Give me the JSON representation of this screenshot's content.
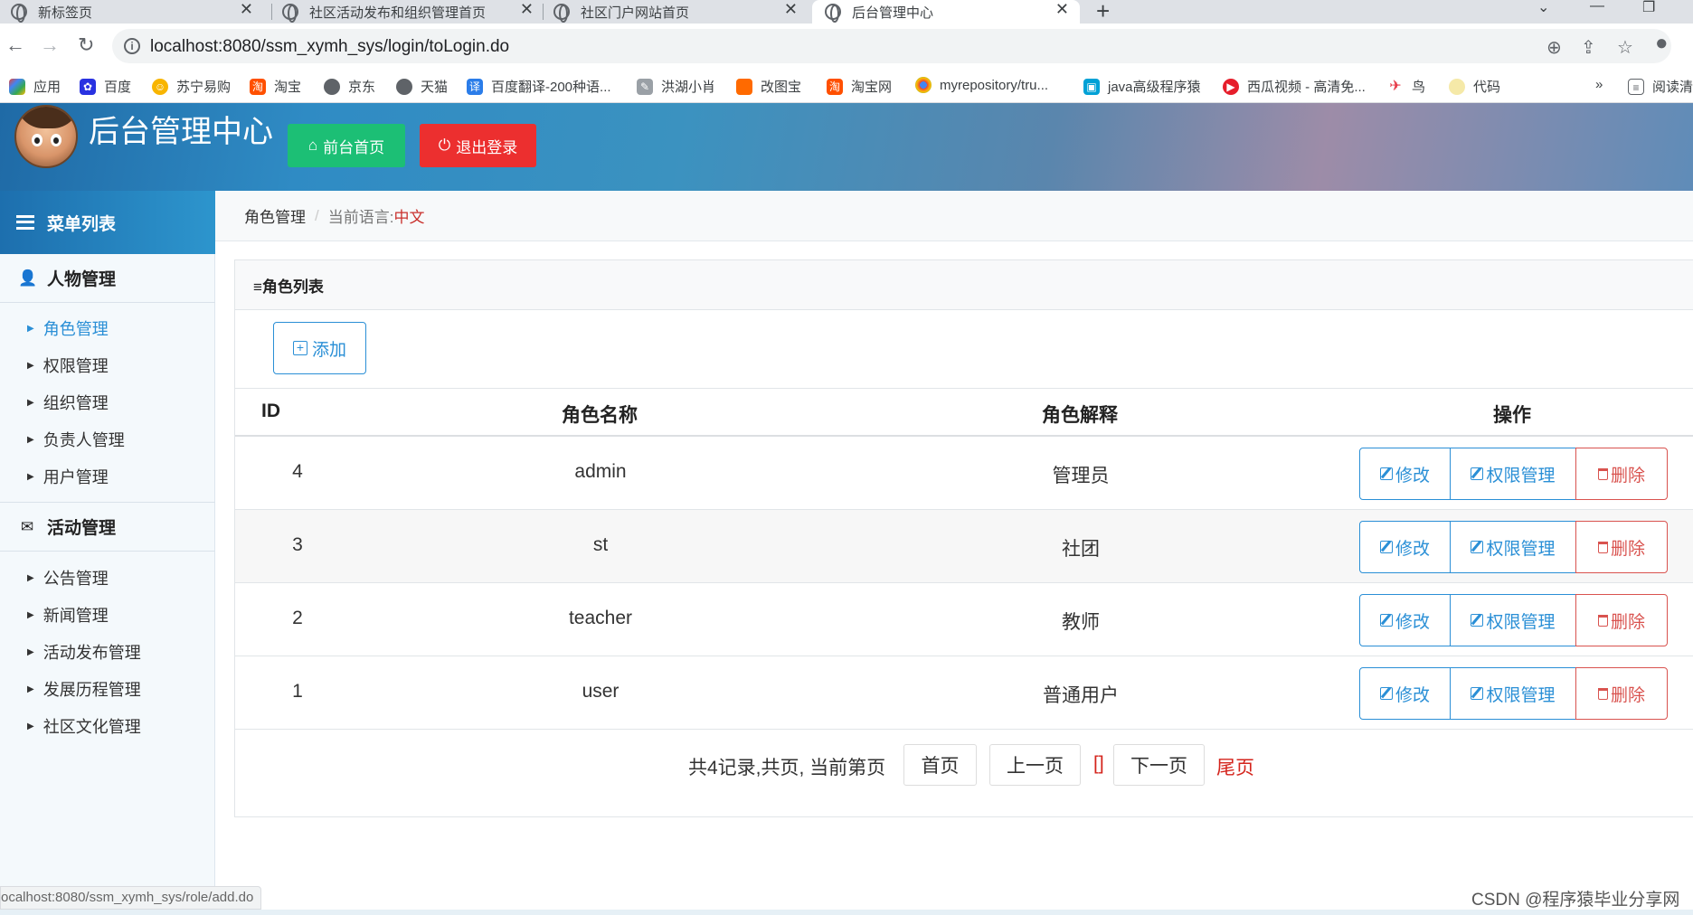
{
  "browser": {
    "tabs": [
      {
        "title": "新标签页"
      },
      {
        "title": "社区活动发布和组织管理首页"
      },
      {
        "title": "社区门户网站首页"
      },
      {
        "title": "后台管理中心"
      }
    ],
    "url": "localhost:8080/ssm_xymh_sys/login/toLogin.do",
    "bookmarks": [
      "应用",
      "百度",
      "苏宁易购",
      "淘宝",
      "京东",
      "天猫",
      "百度翻译-200种语...",
      "洪湖小肖",
      "改图宝",
      "淘宝网",
      "myrepository/tru...",
      "java高级程序猿",
      "西瓜视频 - 高清免...",
      "鸟",
      "代码"
    ],
    "bookmarks_more": "»",
    "reading_list": "阅读清",
    "status_url": "ocalhost:8080/ssm_xymh_sys/role/add.do",
    "watermark": "CSDN @程序猿毕业分享网"
  },
  "header": {
    "title": "后台管理中心",
    "btn_front": "前台首页",
    "btn_logout": "退出登录",
    "colors": {
      "front": "#1cbf75",
      "logout": "#ec2f2f"
    }
  },
  "sidebar": {
    "menu_title": "菜单列表",
    "groups": [
      {
        "title": "人物管理",
        "icon": "user-icon",
        "items": [
          "角色管理",
          "权限管理",
          "组织管理",
          "负责人管理",
          "用户管理"
        ]
      },
      {
        "title": "活动管理",
        "icon": "envelope-icon",
        "items": [
          "公告管理",
          "新闻管理",
          "活动发布管理",
          "发展历程管理",
          "社区文化管理"
        ]
      }
    ],
    "active_item": "角色管理"
  },
  "breadcrumb": {
    "page": "角色管理",
    "lang_label": "当前语言:",
    "lang_value": "中文"
  },
  "panel": {
    "title": "≡角色列表",
    "add_label": "添加",
    "columns": [
      "ID",
      "角色名称",
      "角色解释",
      "操作"
    ],
    "rows": [
      {
        "id": "4",
        "name": "admin",
        "desc": "管理员"
      },
      {
        "id": "3",
        "name": "st",
        "desc": "社团"
      },
      {
        "id": "2",
        "name": "teacher",
        "desc": "教师"
      },
      {
        "id": "1",
        "name": "user",
        "desc": "普通用户"
      }
    ],
    "actions": {
      "edit": "修改",
      "perm": "权限管理",
      "delete": "删除"
    },
    "pager": {
      "summary": "共4记录,共页, 当前第页",
      "first": "首页",
      "prev": "上一页",
      "current": "[]",
      "next": "下一页",
      "last": "尾页"
    }
  }
}
